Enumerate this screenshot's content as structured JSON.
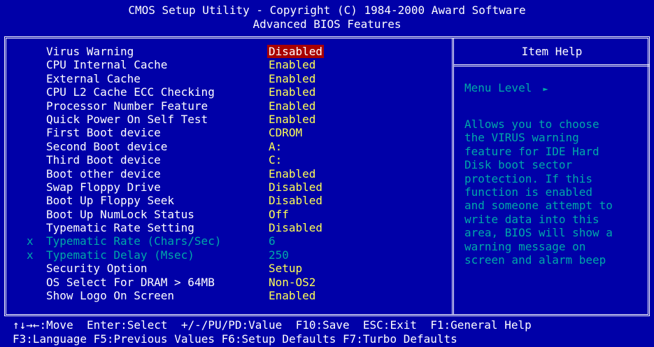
{
  "header": {
    "line1": "CMOS Setup Utility - Copyright (C) 1984-2000 Award Software",
    "line2": "Advanced BIOS Features"
  },
  "settings": [
    {
      "label": "Virus Warning",
      "value": "Disabled",
      "selected": true
    },
    {
      "label": "CPU Internal Cache",
      "value": "Enabled"
    },
    {
      "label": "External Cache",
      "value": "Enabled"
    },
    {
      "label": "CPU L2 Cache ECC Checking",
      "value": "Enabled"
    },
    {
      "label": "Processor Number Feature",
      "value": "Enabled"
    },
    {
      "label": "Quick Power On Self Test",
      "value": "Enabled"
    },
    {
      "label": "First Boot device",
      "value": "CDROM"
    },
    {
      "label": "Second Boot device",
      "value": "A:"
    },
    {
      "label": "Third Boot device",
      "value": "C:"
    },
    {
      "label": "Boot other device",
      "value": "Enabled"
    },
    {
      "label": "Swap Floppy Drive",
      "value": "Disabled"
    },
    {
      "label": "Boot Up Floppy Seek",
      "value": "Disabled"
    },
    {
      "label": "Boot Up NumLock Status",
      "value": "Off"
    },
    {
      "label": "Typematic Rate Setting",
      "value": "Disabled"
    },
    {
      "label": "Typematic Rate (Chars/Sec)",
      "value": "6",
      "disabled": true,
      "mark": "x"
    },
    {
      "label": "Typematic Delay (Msec)",
      "value": "250",
      "disabled": true,
      "mark": "x"
    },
    {
      "label": "Security Option",
      "value": "Setup"
    },
    {
      "label": "OS Select For DRAM > 64MB",
      "value": "Non-OS2"
    },
    {
      "label": "Show Logo On Screen",
      "value": "Enabled"
    }
  ],
  "help": {
    "title": "Item Help",
    "menu_level": "Menu Level",
    "menu_arrow": "►",
    "lines": [
      "Allows you to choose",
      "the VIRUS warning",
      "feature for IDE Hard",
      "Disk boot sector",
      "protection. If this",
      "function is enabled",
      "and someone attempt to",
      "write data into this",
      "area, BIOS will show a",
      "warning message on",
      "screen and alarm beep"
    ]
  },
  "footer": {
    "line1": "↑↓→←:Move  Enter:Select  +/-/PU/PD:Value  F10:Save  ESC:Exit  F1:General Help",
    "line2": "F3:Language F5:Previous Values F6:Setup Defaults F7:Turbo Defaults"
  },
  "colors": {
    "background": "#0000a8",
    "value": "#ffff54",
    "selected_bg": "#a80000",
    "disabled": "#00a8a8"
  }
}
